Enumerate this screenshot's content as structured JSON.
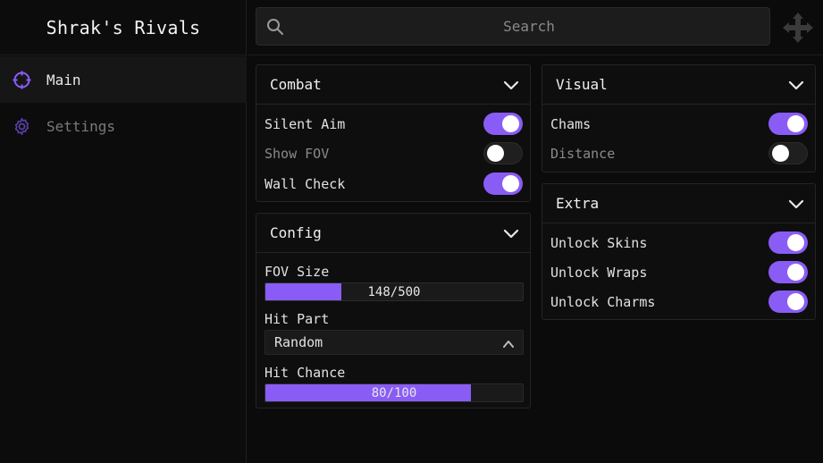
{
  "app": {
    "title": "Shrak's Rivals"
  },
  "accent_color": "#8a5cf6",
  "sidebar": {
    "items": [
      {
        "label": "Main",
        "icon": "crosshair-icon",
        "active": true
      },
      {
        "label": "Settings",
        "icon": "gear-icon",
        "active": false
      }
    ]
  },
  "search": {
    "placeholder": "Search",
    "value": ""
  },
  "panels": {
    "combat": {
      "title": "Combat",
      "toggles": [
        {
          "label": "Silent Aim",
          "on": true
        },
        {
          "label": "Show FOV",
          "on": false
        },
        {
          "label": "Wall Check",
          "on": true
        }
      ]
    },
    "config": {
      "title": "Config",
      "fov_size": {
        "label": "FOV Size",
        "value": 148,
        "max": 500,
        "display": "148/500"
      },
      "hit_part": {
        "label": "Hit Part",
        "selected": "Random"
      },
      "hit_chance": {
        "label": "Hit Chance",
        "value": 80,
        "max": 100,
        "display": "80/100"
      }
    },
    "visual": {
      "title": "Visual",
      "toggles": [
        {
          "label": "Chams",
          "on": true
        },
        {
          "label": "Distance",
          "on": false
        }
      ]
    },
    "extra": {
      "title": "Extra",
      "toggles": [
        {
          "label": "Unlock Skins",
          "on": true
        },
        {
          "label": "Unlock Wraps",
          "on": true
        },
        {
          "label": "Unlock Charms",
          "on": true
        }
      ]
    }
  }
}
